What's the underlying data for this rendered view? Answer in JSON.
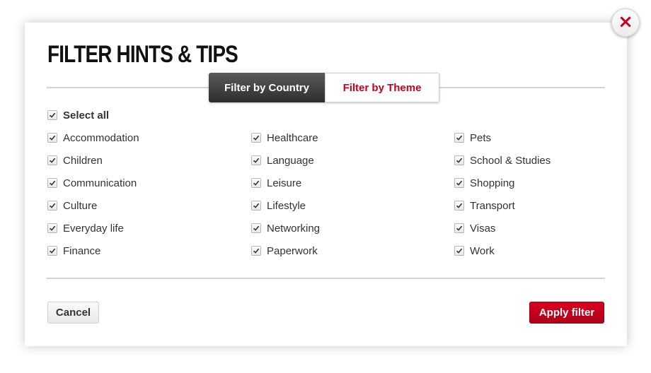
{
  "modal": {
    "title": "FILTER HINTS & TIPS",
    "close_icon": "close-icon",
    "accent_color": "#c8001e"
  },
  "tabs": [
    {
      "label": "Filter by Country",
      "active": true
    },
    {
      "label": "Filter by Theme",
      "active": false
    }
  ],
  "select_all": {
    "label": "Select all",
    "checked": true
  },
  "columns": [
    [
      {
        "label": "Accommodation",
        "checked": true
      },
      {
        "label": "Children",
        "checked": true
      },
      {
        "label": "Communication",
        "checked": true
      },
      {
        "label": "Culture",
        "checked": true
      },
      {
        "label": "Everyday life",
        "checked": true
      },
      {
        "label": "Finance",
        "checked": true
      }
    ],
    [
      {
        "label": "Healthcare",
        "checked": true
      },
      {
        "label": "Language",
        "checked": true
      },
      {
        "label": "Leisure",
        "checked": true
      },
      {
        "label": "Lifestyle",
        "checked": true
      },
      {
        "label": "Networking",
        "checked": true
      },
      {
        "label": "Paperwork",
        "checked": true
      }
    ],
    [
      {
        "label": "Pets",
        "checked": true
      },
      {
        "label": "School & Studies",
        "checked": true
      },
      {
        "label": "Shopping",
        "checked": true
      },
      {
        "label": "Transport",
        "checked": true
      },
      {
        "label": "Visas",
        "checked": true
      },
      {
        "label": "Work",
        "checked": true
      }
    ]
  ],
  "buttons": {
    "cancel": "Cancel",
    "apply": "Apply filter"
  }
}
